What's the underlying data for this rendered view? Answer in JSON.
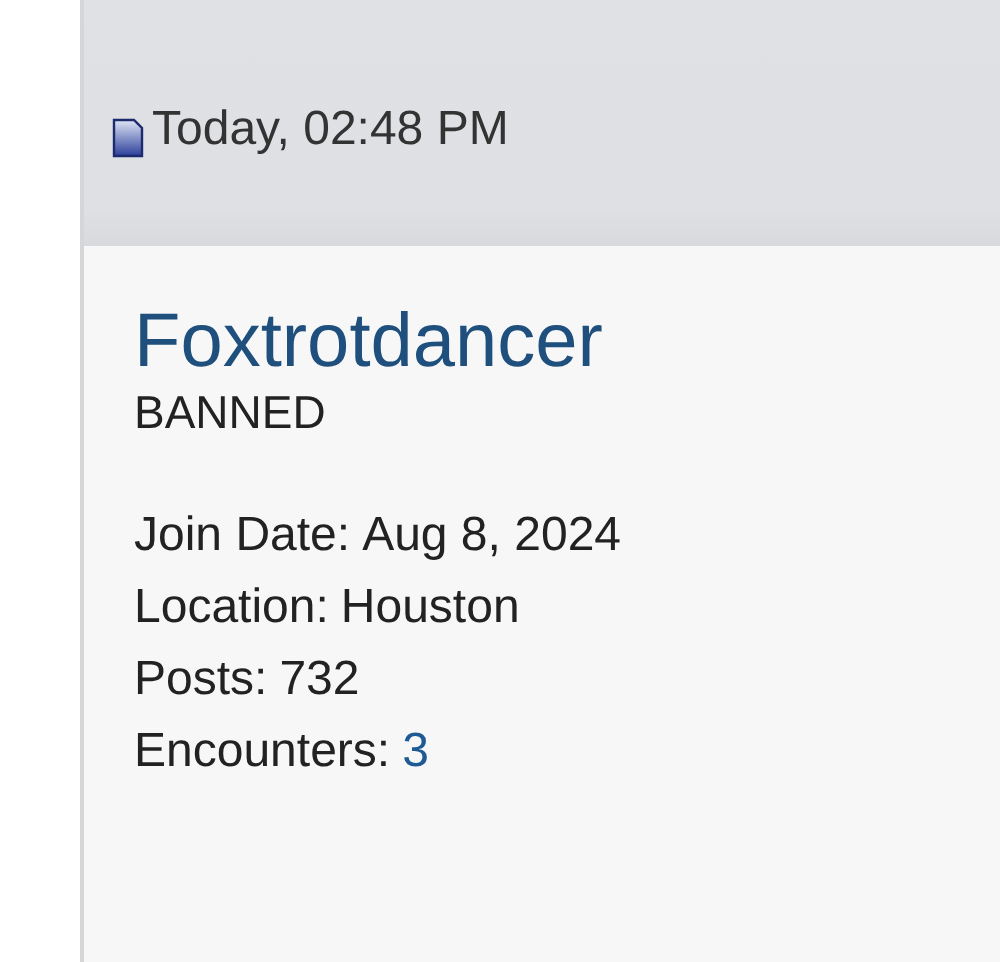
{
  "post_header": {
    "date": "Today, 02:48 PM"
  },
  "user": {
    "name": "Foxtrotdancer",
    "title": "BANNED"
  },
  "stats": [
    {
      "label": "Join Date:",
      "value": "Aug 8, 2024",
      "kind": "text"
    },
    {
      "label": "Location:",
      "value": "Houston",
      "kind": "text"
    },
    {
      "label": "Posts:",
      "value": "732",
      "kind": "text"
    },
    {
      "label": "Encounters:",
      "value": "3",
      "kind": "link"
    }
  ]
}
